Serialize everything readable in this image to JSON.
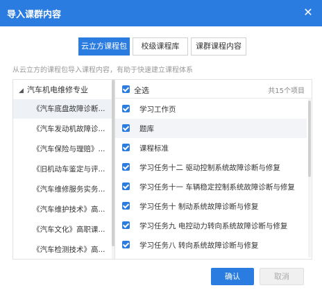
{
  "dialog": {
    "title": "导入课群内容",
    "close_icon": "close-icon"
  },
  "tabs": [
    {
      "label": "云立方课程包",
      "active": true
    },
    {
      "label": "校级课程库",
      "active": false
    },
    {
      "label": "课群课程内容",
      "active": false
    }
  ],
  "hint": "从云立方的课程包导入课程内容，有助于快速建立课程体系",
  "tree": {
    "root_label": "汽车机电维修专业",
    "courses": [
      {
        "label": "《汽车底盘故障诊断...",
        "active": true
      },
      {
        "label": "《汽车发动机故障诊...",
        "active": false
      },
      {
        "label": "《汽车保险与理赔》...",
        "active": false
      },
      {
        "label": "《旧机动车鉴定与评...",
        "active": false
      },
      {
        "label": "《汽车维修服务实务...",
        "active": false
      },
      {
        "label": "《汽车维护技术》高...",
        "active": false
      },
      {
        "label": "《汽车文化》高职课...",
        "active": false
      },
      {
        "label": "《汽车检测技术》高...",
        "active": false
      }
    ]
  },
  "content": {
    "select_all_label": "全选",
    "count_text": "共15个项目",
    "items": [
      {
        "label": "学习工作页",
        "checked": true
      },
      {
        "label": "题库",
        "checked": true
      },
      {
        "label": "课程标准",
        "checked": true
      },
      {
        "label": "学习任务十二 驱动控制系统故障诊断与修复",
        "checked": true
      },
      {
        "label": "学习任务十一 车辆稳定控制系统故障诊断与修复",
        "checked": true
      },
      {
        "label": "学习任务十 制动系统故障诊断与修复",
        "checked": true
      },
      {
        "label": "学习任务九 电控动力转向系统故障诊断与修复",
        "checked": true
      },
      {
        "label": "学习任务八 转向系统故障诊断与修复",
        "checked": true
      }
    ]
  },
  "buttons": {
    "confirm": "确认",
    "cancel": "取消"
  },
  "colors": {
    "accent": "#2b7ce0"
  }
}
